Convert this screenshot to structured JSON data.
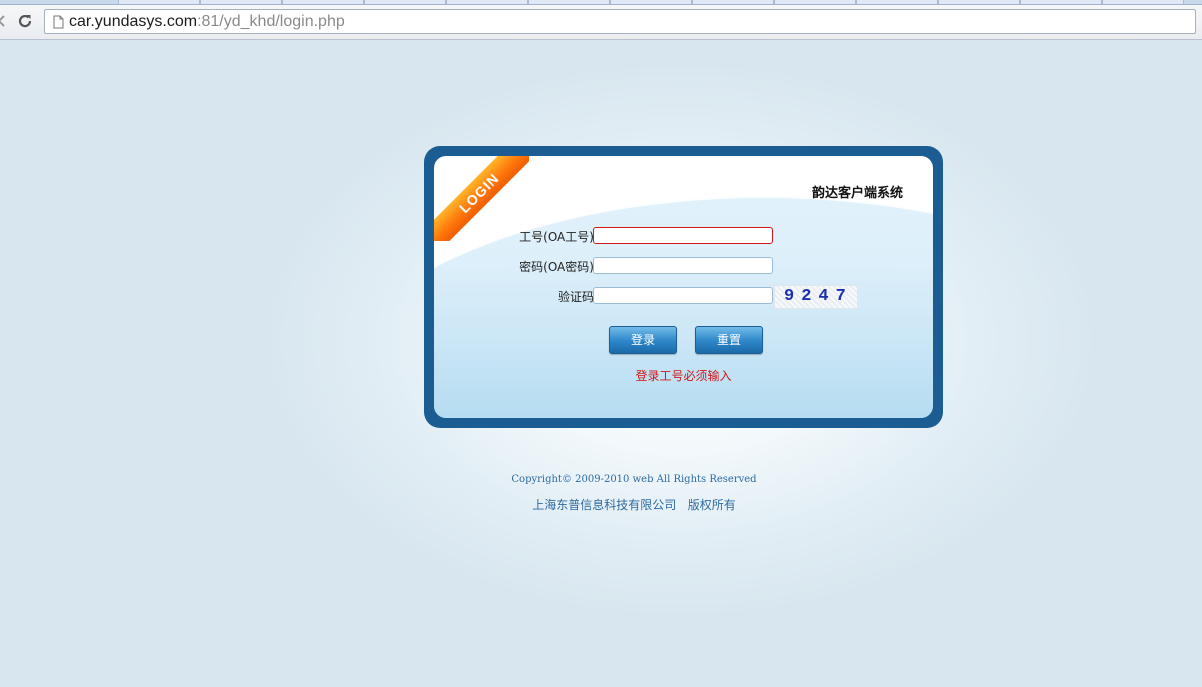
{
  "browser": {
    "url_host": "car.yundasys.com",
    "url_rest": ":81/yd_khd/login.php"
  },
  "login": {
    "ribbon_text": "LOGIN",
    "system_title": "韵达客户端系统",
    "fields": [
      {
        "label": "工号(OA工号):",
        "value": ""
      },
      {
        "label": "密码(OA密码):",
        "value": ""
      },
      {
        "label": "验证码:",
        "value": ""
      }
    ],
    "captcha_text": "9247",
    "login_button": "登录",
    "reset_button": "重置",
    "error_message": "登录工号必须输入"
  },
  "footer": {
    "copyright": "Copyright© 2009-2010 web All Rights Reserved",
    "company": "上海东普信息科技有限公司   版权所有"
  },
  "colors": {
    "panel_border": "#1b5d92",
    "ribbon": "#ff7b0c",
    "error": "#d01818",
    "footer_text": "#2e6aa0"
  }
}
